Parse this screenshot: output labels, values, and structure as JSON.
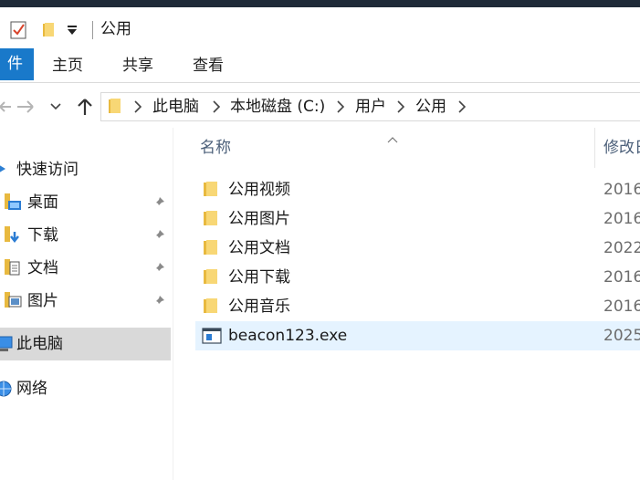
{
  "window": {
    "title": "公用"
  },
  "ribbon": {
    "file_tab": "件",
    "tabs": [
      "主页",
      "共享",
      "查看"
    ]
  },
  "address_bar": {
    "crumbs": [
      "此电脑",
      "本地磁盘 (C:)",
      "用户",
      "公用"
    ]
  },
  "nav_pane": {
    "quick_access": "快速访问",
    "pinned": [
      {
        "label": "桌面",
        "icon": "desktop-folder-icon"
      },
      {
        "label": "下载",
        "icon": "downloads-folder-icon"
      },
      {
        "label": "文档",
        "icon": "documents-folder-icon"
      },
      {
        "label": "图片",
        "icon": "pictures-folder-icon"
      }
    ],
    "this_pc": "此电脑",
    "network": "网络"
  },
  "content": {
    "columns": {
      "name": "名称",
      "date": "修改日"
    },
    "files": [
      {
        "name": "公用视频",
        "date": "2016",
        "type": "folder"
      },
      {
        "name": "公用图片",
        "date": "2016",
        "type": "folder"
      },
      {
        "name": "公用文档",
        "date": "2022",
        "type": "folder"
      },
      {
        "name": "公用下载",
        "date": "2016",
        "type": "folder"
      },
      {
        "name": "公用音乐",
        "date": "2016",
        "type": "folder"
      },
      {
        "name": "beacon123.exe",
        "date": "2025",
        "type": "exe"
      }
    ]
  },
  "colors": {
    "accent": "#1979ca",
    "selected_row": "#e5f3ff",
    "nav_selected": "#d9d9d9",
    "folder_yellow": "#f8d775"
  }
}
